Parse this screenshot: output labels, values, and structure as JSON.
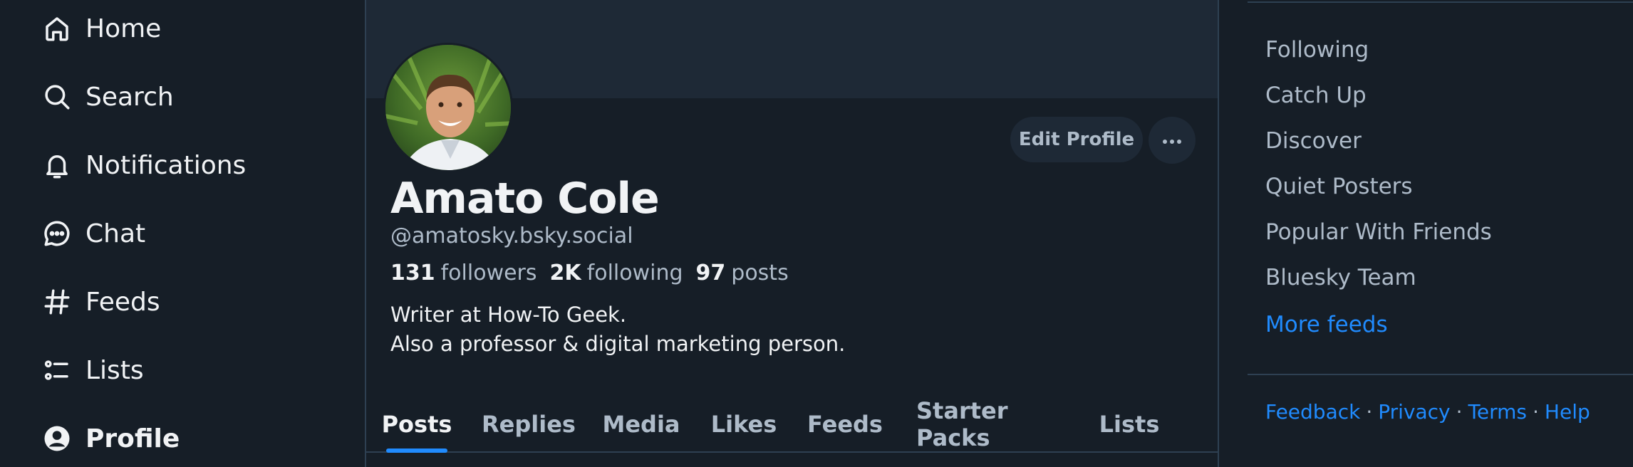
{
  "nav": {
    "items": [
      {
        "label": "Home",
        "icon": "home-icon"
      },
      {
        "label": "Search",
        "icon": "search-icon"
      },
      {
        "label": "Notifications",
        "icon": "bell-icon"
      },
      {
        "label": "Chat",
        "icon": "chat-bubble-icon"
      },
      {
        "label": "Feeds",
        "icon": "hash-icon"
      },
      {
        "label": "Lists",
        "icon": "list-icon"
      },
      {
        "label": "Profile",
        "icon": "user-circle-icon",
        "active": true
      }
    ]
  },
  "profile": {
    "display_name": "Amato Cole",
    "handle": "@amatosky.bsky.social",
    "followers_count": "131",
    "followers_label": "followers",
    "following_count": "2K",
    "following_label": "following",
    "posts_count": "97",
    "posts_label": "posts",
    "bio_line1": "Writer at How-To Geek.",
    "bio_line2": "Also a professor & digital marketing person.",
    "edit_label": "Edit Profile",
    "more_label": "···"
  },
  "tabs": [
    "Posts",
    "Replies",
    "Media",
    "Likes",
    "Feeds",
    "Starter Packs",
    "Lists"
  ],
  "active_tab": "Posts",
  "right": {
    "feeds": [
      "Following",
      "Catch Up",
      "Discover",
      "Quiet Posters",
      "Popular With Friends",
      "Bluesky Team"
    ],
    "more_feeds": "More feeds",
    "footer": [
      "Feedback",
      "Privacy",
      "Terms",
      "Help"
    ],
    "separator": "·"
  },
  "colors": {
    "background": "#161e27",
    "banner": "#1e2936",
    "accent": "#208bfe",
    "muted_text": "#aebbc9",
    "text": "#f1f3f5",
    "border": "#2e4052"
  }
}
